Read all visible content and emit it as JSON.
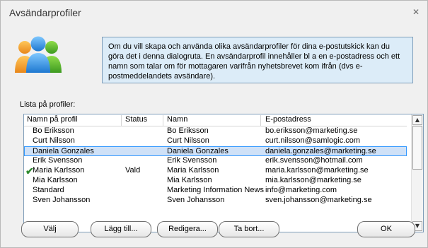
{
  "window": {
    "title": "Avsändarprofiler",
    "close_glyph": "✕"
  },
  "info": {
    "text": "Om du vill skapa och använda olika avsändarprofiler för dina e-postutskick kan du göra det i denna dialogruta. En avsändarprofil innehåller bl a en e-postadress och ett namn som talar om för mottagaren varifrån nyhetsbrevet kom ifrån (dvs e-postmeddelandets avsändare)."
  },
  "list": {
    "label": "Lista på profiler:",
    "columns": [
      "Namn på profil",
      "Status",
      "Namn",
      "E-postadress"
    ],
    "rows": [
      {
        "profile": "Bo Eriksson",
        "status": "",
        "name": "Bo Eriksson",
        "email": "bo.eriksson@marketing.se",
        "selected": false,
        "checked": false
      },
      {
        "profile": "Curt Nilsson",
        "status": "",
        "name": "Curt Nilsson",
        "email": "curt.nilsson@samlogic.com",
        "selected": false,
        "checked": false
      },
      {
        "profile": "Daniela Gonzales",
        "status": "",
        "name": "Daniela Gonzales",
        "email": "daniela.gonzales@marketing.se",
        "selected": true,
        "checked": false
      },
      {
        "profile": "Erik Svensson",
        "status": "",
        "name": "Erik Svensson",
        "email": "erik.svensson@hotmail.com",
        "selected": false,
        "checked": false
      },
      {
        "profile": "Maria Karlsson",
        "status": "Vald",
        "name": "Maria Karlsson",
        "email": "maria.karlsson@marketing.se",
        "selected": false,
        "checked": true
      },
      {
        "profile": "Mia Karlsson",
        "status": "",
        "name": "Mia Karlsson",
        "email": "mia.karlsson@marketing.se",
        "selected": false,
        "checked": false
      },
      {
        "profile": "Standard",
        "status": "",
        "name": "Marketing Information News",
        "email": "info@marketing.com",
        "selected": false,
        "checked": false
      },
      {
        "profile": "Sven Johansson",
        "status": "",
        "name": "Sven Johansson",
        "email": "sven.johansson@marketing.se",
        "selected": false,
        "checked": false
      }
    ]
  },
  "buttons": {
    "select": "Välj",
    "add": "Lägg till...",
    "edit": "Redigera...",
    "remove": "Ta bort...",
    "ok": "OK"
  }
}
